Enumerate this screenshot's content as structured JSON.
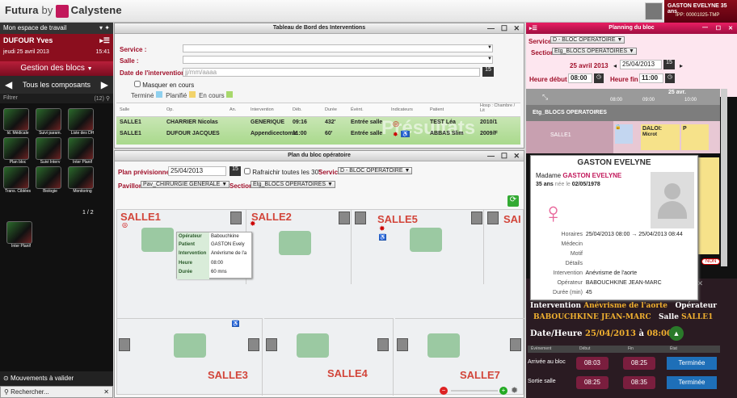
{
  "app": {
    "brand": "Futura",
    "by": "by",
    "product": "Calystene"
  },
  "user": {
    "name": "GASTON EVELYNE 35 ans",
    "id": "IPP: 00001025-TMP"
  },
  "sidebar": {
    "space": "Mon espace de travail",
    "user": "DUFOUR Yves",
    "date": "jeudi 25 avril 2013",
    "time": "15:41",
    "section": "Gestion des blocs",
    "all": "Tous les composants",
    "filter": "Filtrer",
    "count": "(12)",
    "tiles": [
      "Id. Médicale",
      "Suivi param.",
      "Liste des DH",
      "Plan bloc",
      "Suivi Interv",
      "Inter Planif",
      "Trans. Ciblées",
      "Biologie",
      "Monitoring"
    ],
    "page": "1 / 2",
    "tile_extra": "Inter Planif",
    "pending": "Mouvements à valider",
    "search": "Rechercher..."
  },
  "dashboard": {
    "title": "Tableau de Bord des Interventions",
    "service_label": "Service :",
    "salle_label": "Salle :",
    "date_label": "Date de l'intervention",
    "date_placeholder": "jj/mm/aaaa",
    "date_btn": "15",
    "hide": "Masquer en cours",
    "legend": [
      "Terminé",
      "Planifié",
      "En cours"
    ],
    "headers": [
      "Salle",
      "Op.",
      "An.",
      "Intervention",
      "Déb.",
      "Durée",
      "Évènt.",
      "Indicateurs",
      "Patient",
      "Hosp : Chambre / Lit"
    ],
    "rows": [
      [
        "SALLE1",
        "CHARRIER Nicolas",
        "",
        "GENERIQUE",
        "09:16",
        "432'",
        "Entrée salle",
        "",
        "TEST Léa",
        "2010/1"
      ],
      [
        "SALLE1",
        "DUFOUR JACQUES",
        "",
        "Appendicectomie",
        "11:00",
        "60'",
        "Entrée salle",
        "",
        "ABBAS Slim",
        "2009/F"
      ]
    ],
    "watermark": "Présultats"
  },
  "plan": {
    "title": "Plan du bloc opératoire",
    "prev_label": "Plan prévisionnel",
    "prev_date": "25/04/2013",
    "date_btn": "15",
    "refresh": "Rafraichir toutes les 30\"",
    "service_label": "Service",
    "service_value": "D - BLOC OPERATOIRE",
    "pav_label": "Pavillon",
    "pav_value": "Pav_CHIRURGIE GENERALE",
    "section_label": "Section",
    "section_value": "Etg_BLOCS OPERATOIRES",
    "rooms": [
      "SALLE1",
      "SALLE2",
      "SALLE5",
      "SAI",
      "SALLE3",
      "SALLE4",
      "SALLE7"
    ],
    "tooltip": {
      "labels": [
        "Opérateur",
        "Patient",
        "Intervention",
        "Heure",
        "Durée"
      ],
      "values": [
        "Babouchkine",
        "GASTON Evely",
        "Anévrisme de l'a",
        "08:00",
        "60 mns"
      ]
    }
  },
  "planning": {
    "title": "Planning du bloc",
    "service_label": "Service",
    "service_value": "D - BLOC OPERATOIRE",
    "section_label": "Section",
    "section_value": "Etg_BLOCS OPERATOIRES",
    "day": "25 avril 2013",
    "date": "25/04/2013",
    "date_btn": "15",
    "start_label": "Heure début",
    "start": "08:00",
    "end_label": "Heure fin",
    "end": "11:00",
    "col_date": "25 avr.",
    "cols": [
      "08:00",
      "09:00",
      "10:00"
    ],
    "group": "Etg_BLOCS OPERATOIRES",
    "room": "SALLE1",
    "bars": [
      "DALOI:",
      "P",
      "Microt"
    ],
    "non": "NON",
    "intervention_label": "Intervention",
    "intervention": "Anévrisme de l'aorte",
    "op_label": "Opérateur",
    "op": "BABOUCHKINE JEAN-MARC",
    "salle_label": "Salle",
    "salle": "SALLE1",
    "dh_label": "Date/Heure",
    "dh": "25/04/2013",
    "dh_at": "à",
    "dh_time": "08:00",
    "ev_headers": [
      "Évènement",
      "Début",
      "Fin",
      "État"
    ],
    "events": [
      {
        "name": "Arrivée au bloc",
        "start": "08:03",
        "end": "08:25",
        "state": "Terminée"
      },
      {
        "name": "Sortie salle",
        "start": "08:25",
        "end": "08:35",
        "state": "Terminée"
      }
    ]
  },
  "patient": {
    "name": "GASTON EVELYNE",
    "title": "Madame",
    "fullname": "GASTON EVELYNE",
    "age": "35 ans",
    "born": "née le",
    "dob": "02/05/1978",
    "labels": [
      "Horaires",
      "Médecin",
      "Motif",
      "Détails",
      "Intervention",
      "Opérateur",
      "Durée (min)"
    ],
    "values": [
      "25/04/2013 08:00 → 25/04/2013 08:44",
      "",
      "",
      "",
      "Anévrisme de l'aorte",
      "BABOUCHKINE JEAN-MARC",
      "45"
    ]
  }
}
